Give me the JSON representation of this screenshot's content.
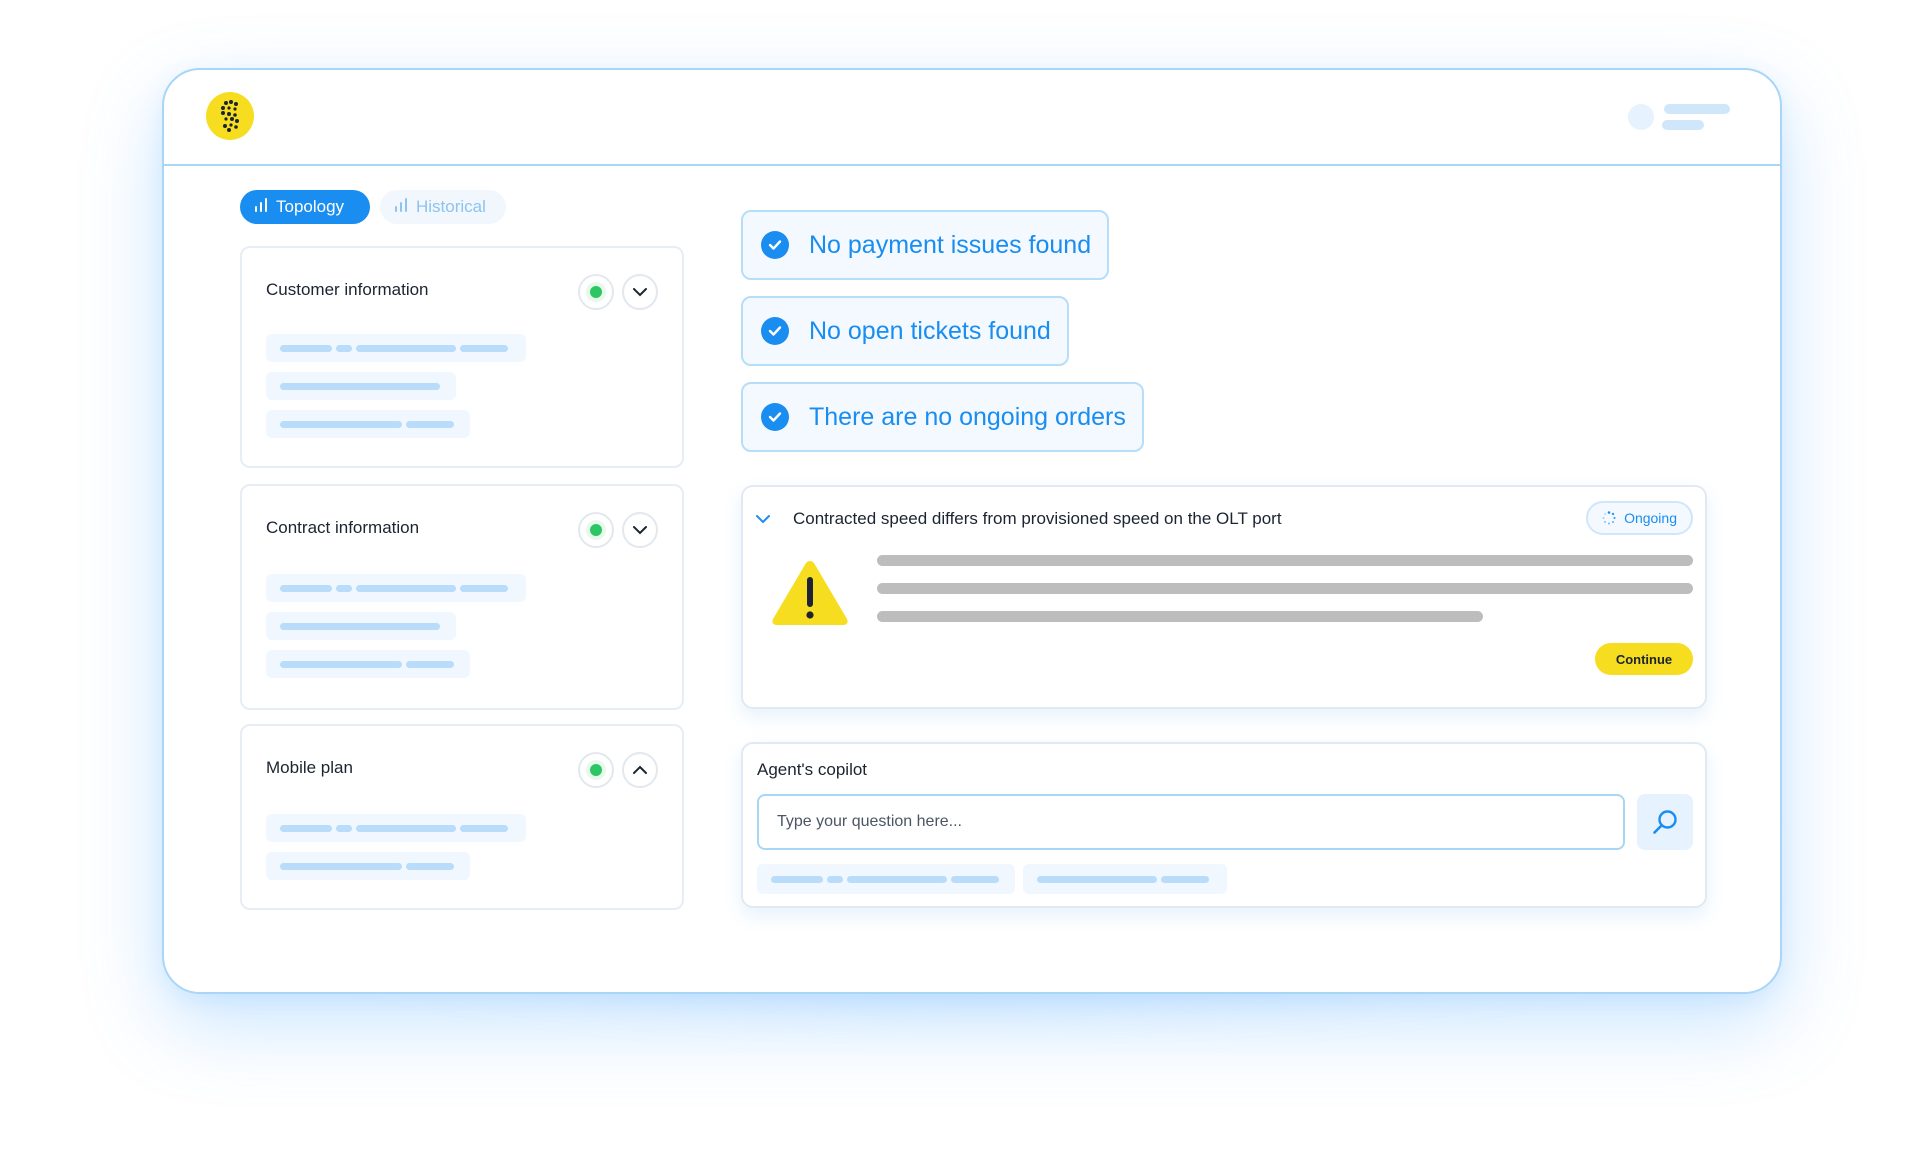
{
  "header": {
    "logo_icon": "coin-logo-icon",
    "user_icon": "user-avatar-icon"
  },
  "tabs": [
    {
      "label": "Topology",
      "active": true,
      "icon": "bar-chart-icon"
    },
    {
      "label": "Historical",
      "active": false,
      "icon": "bar-chart-icon"
    }
  ],
  "cards": [
    {
      "title": "Customer information",
      "status": "ok",
      "expanded": false
    },
    {
      "title": "Contract information",
      "status": "ok",
      "expanded": false
    },
    {
      "title": "Mobile plan",
      "status": "ok",
      "expanded": true
    }
  ],
  "checks": [
    {
      "text": "No payment issues found"
    },
    {
      "text": "No open tickets found"
    },
    {
      "text": "There are no ongoing orders"
    }
  ],
  "alert": {
    "title": "Contracted speed differs from provisioned speed on the OLT port",
    "status_label": "Ongoing",
    "action_label": "Continue",
    "icon": "warning-icon"
  },
  "copilot": {
    "title": "Agent's copilot",
    "input_placeholder": "Type your question here...",
    "search_icon": "search-icon"
  },
  "colors": {
    "accent": "#1a8df0",
    "brand_yellow": "#f7dd1f",
    "status_ok": "#2cc764",
    "border_light": "#a9d6f6"
  }
}
